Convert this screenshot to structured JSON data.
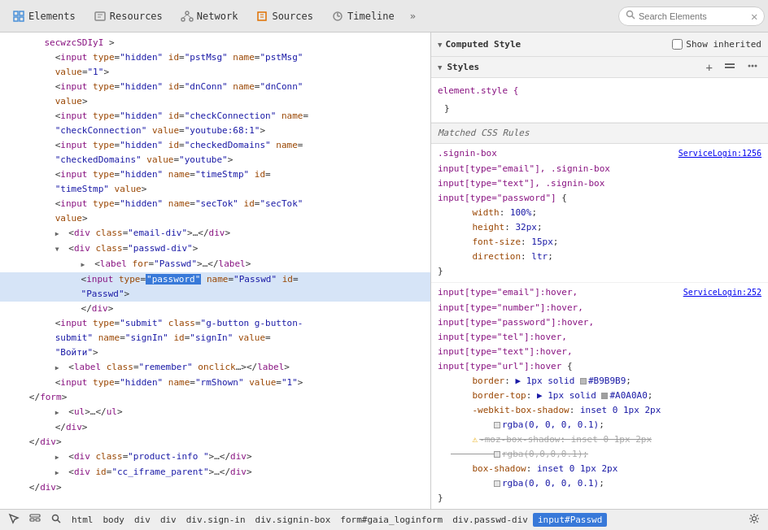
{
  "toolbar": {
    "tabs": [
      {
        "id": "elements",
        "label": "Elements",
        "icon": "elements"
      },
      {
        "id": "resources",
        "label": "Resources",
        "icon": "resources"
      },
      {
        "id": "network",
        "label": "Network",
        "icon": "network"
      },
      {
        "id": "sources",
        "label": "Sources",
        "icon": "sources"
      },
      {
        "id": "timeline",
        "label": "Timeline",
        "icon": "timeline"
      }
    ],
    "more_label": "»",
    "search_placeholder": "Search Elements"
  },
  "dom": {
    "lines": [
      {
        "indent": 1,
        "html": "secwzcSDIyI &gt;"
      },
      {
        "indent": 2,
        "html": "&lt;<span class='tag-name'>input</span> <span class='attr-name'>type</span>=<span class='attr-value'>\"hidden\"</span> <span class='attr-name'>id</span>=<span class='attr-value'>\"pstMsg\"</span> <span class='attr-name'>name</span>=<span class='attr-value'>\"pstMsg\"</span>"
      },
      {
        "indent": 2,
        "html": "<span class='attr-name'>value</span>=<span class='attr-value'>\"1\"</span>&gt;"
      },
      {
        "indent": 2,
        "html": "&lt;<span class='tag-name'>input</span> <span class='attr-name'>type</span>=<span class='attr-value'>\"hidden\"</span> <span class='attr-name'>id</span>=<span class='attr-value'>\"dnConn\"</span> <span class='attr-name'>name</span>=<span class='attr-value'>\"dnConn\"</span>"
      },
      {
        "indent": 2,
        "html": "<span class='attr-name'>value</span>&gt;"
      },
      {
        "indent": 2,
        "html": "&lt;<span class='tag-name'>input</span> <span class='attr-name'>type</span>=<span class='attr-value'>\"hidden\"</span> <span class='attr-name'>id</span>=<span class='attr-value'>\"checkConnection\"</span> <span class='attr-name'>name</span>="
      },
      {
        "indent": 2,
        "html": "<span class='attr-value'>\"checkConnection\"</span> <span class='attr-name'>value</span>=<span class='attr-value'>\"youtube:68:1\"</span>&gt;"
      },
      {
        "indent": 2,
        "html": "&lt;<span class='tag-name'>input</span> <span class='attr-name'>type</span>=<span class='attr-value'>\"hidden\"</span> <span class='attr-name'>id</span>=<span class='attr-value'>\"checkedDomains\"</span> <span class='attr-name'>name</span>="
      },
      {
        "indent": 2,
        "html": "<span class='attr-value'>\"checkedDomains\"</span> <span class='attr-name'>value</span>=<span class='attr-value'>\"youtube\"</span>&gt;"
      },
      {
        "indent": 2,
        "html": "&lt;<span class='tag-name'>input</span> <span class='attr-name'>type</span>=<span class='attr-value'>\"hidden\"</span> <span class='attr-name'>name</span>=<span class='attr-value'>\"timeStmp\"</span> <span class='attr-name'>id</span>="
      },
      {
        "indent": 2,
        "html": "<span class='attr-value'>\"timeStmp\"</span> <span class='attr-name'>value</span>&gt;"
      },
      {
        "indent": 2,
        "html": "&lt;<span class='tag-name'>input</span> <span class='attr-name'>type</span>=<span class='attr-value'>\"hidden\"</span> <span class='attr-name'>name</span>=<span class='attr-value'>\"secTok\"</span> <span class='attr-name'>id</span>=<span class='attr-value'>\"secTok\"</span>"
      },
      {
        "indent": 2,
        "html": "<span class='attr-name'>value</span>&gt;"
      },
      {
        "indent": 2,
        "html": "<span class='triangle triangle-right'></span> &lt;<span class='tag-name'>div</span> <span class='attr-name'>class</span>=<span class='attr-value'>\"email-div\"</span>&gt;…&lt;/<span class='tag-name'>div</span>&gt;"
      },
      {
        "indent": 2,
        "html": "<span class='triangle triangle-down'></span> &lt;<span class='tag-name'>div</span> <span class='attr-name'>class</span>=<span class='attr-value'>\"passwd-div\"</span>&gt;"
      },
      {
        "indent": 3,
        "html": "<span class='triangle triangle-right'></span> &lt;<span class='tag-name'>label</span> <span class='attr-name'>for</span>=<span class='attr-value'>\"Passwd\"</span>&gt;…&lt;/<span class='tag-name'>label</span>&gt;"
      },
      {
        "indent": 3,
        "html": "&lt;<span class='tag-name'>input</span> <span class='attr-name'>type</span>=<span class='attr-value-highlight'>\"password\"</span> <span class='attr-name'>name</span>=<span class='attr-value'>\"Passwd\"</span> <span class='attr-name'>id</span>=",
        "selected": true
      },
      {
        "indent": 3,
        "html": "<span class='attr-value'>\"Passwd\"</span>&gt;",
        "selected": true
      },
      {
        "indent": 3,
        "html": "&lt;/<span class='tag-name'>div</span>&gt;"
      },
      {
        "indent": 2,
        "html": "&lt;<span class='tag-name'>input</span> <span class='attr-name'>type</span>=<span class='attr-value'>\"submit\"</span> <span class='attr-name'>class</span>=<span class='attr-value'>\"g-button g-button-"
      },
      {
        "indent": 2,
        "html": "<span class='attr-value'>submit\"</span> <span class='attr-name'>name</span>=<span class='attr-value'>\"signIn\"</span> <span class='attr-name'>id</span>=<span class='attr-value'>\"signIn\"</span> <span class='attr-name'>value</span>="
      },
      {
        "indent": 2,
        "html": "<span class='attr-value'>\"Войти\"</span>&gt;"
      },
      {
        "indent": 2,
        "html": "<span class='triangle triangle-right'></span> &lt;<span class='tag-name'>label</span> <span class='attr-name'>class</span>=<span class='attr-value'>\"remember\"</span> <span class='attr-name'>onclick</span>…&gt;&lt;/<span class='tag-name'>label</span>&gt;"
      },
      {
        "indent": 2,
        "html": "&lt;<span class='tag-name'>input</span> <span class='attr-name'>type</span>=<span class='attr-value'>\"hidden\"</span> <span class='attr-name'>name</span>=<span class='attr-value'>\"rmShown\"</span> <span class='attr-name'>value</span>=<span class='attr-value'>\"1\"</span>&gt;"
      },
      {
        "indent": 1,
        "html": "&lt;/<span class='tag-name'>form</span>&gt;"
      },
      {
        "indent": 2,
        "html": "<span class='triangle triangle-right'></span> &lt;<span class='tag-name'>ul</span>&gt;…&lt;/<span class='tag-name'>ul</span>&gt;"
      },
      {
        "indent": 2,
        "html": "&lt;/<span class='tag-name'>div</span>&gt;"
      },
      {
        "indent": 1,
        "html": "&lt;/<span class='tag-name'>div</span>&gt;"
      },
      {
        "indent": 2,
        "html": "<span class='triangle triangle-right'></span> &lt;<span class='tag-name'>div</span> <span class='attr-name'>class</span>=<span class='attr-value'>\"product-info \"</span>&gt;…&lt;/<span class='tag-name'>div</span>&gt;"
      },
      {
        "indent": 2,
        "html": "<span class='triangle triangle-right'></span> &lt;<span class='tag-name'>div</span> <span class='attr-name'>id</span>=<span class='attr-value'>\"cc_iframe_parent\"</span>&gt;…&lt;/<span class='tag-name'>div</span>&gt;"
      },
      {
        "indent": 1,
        "html": "&lt;/<span class='tag-name'>div</span>&gt;"
      }
    ]
  },
  "styles": {
    "computed_title": "Computed Style",
    "show_inherited_label": "Show inherited",
    "styles_title": "Styles",
    "element_style": "element.style {",
    "element_style_close": "}",
    "matched_css_label": "Matched CSS Rules",
    "rules": [
      {
        "selector": ".signin-box",
        "source": "ServiceLogin:1256",
        "extra_selectors": [
          "input[type=\"email\"], .signin-box",
          "input[type=\"text\"], .signin-box",
          "input[type=\"password\"] {"
        ],
        "properties": [
          {
            "name": "width",
            "value": "100%;"
          },
          {
            "name": "height",
            "value": "32px;"
          },
          {
            "name": "font-size",
            "value": "15px;"
          },
          {
            "name": "direction",
            "value": "ltr;"
          }
        ]
      },
      {
        "selector": "input[type=\"email\"]:hover,",
        "source": "ServiceLogin:252",
        "extra_selectors": [
          "input[type=\"number\"]:hover,",
          "input[type=\"password\"]:hover,",
          "input[type=\"tel\"]:hover,",
          "input[type=\"text\"]:hover,",
          "input[type=\"url\"]:hover {"
        ],
        "properties": [
          {
            "name": "border",
            "value": "1px solid",
            "color": "#B9B9B9",
            "color_val": "#B9B9B9;"
          },
          {
            "name": "border-top",
            "value": "1px solid",
            "color": "#A0A0A0",
            "color_val": "#A0A0A0;"
          },
          {
            "name": "-webkit-box-shadow",
            "value": "inset 0 1px 2px rgba(0, 0, 0, 0.1);"
          },
          {
            "name": "-moz-box-shadow",
            "value": "inset 0 1px 2px rgba(0,0,0,0.1);",
            "strikethrough": true
          },
          {
            "name": "box-shadow",
            "value": "inset 0 1px 2px",
            "color": "rgba(0,0,0,0.1)",
            "color_val": "rgba(0, 0, 0, 0.1);"
          }
        ]
      }
    ]
  },
  "breadcrumb": {
    "icons": [
      "select-icon",
      "dom-icon",
      "search-icon"
    ],
    "items": [
      "html",
      "body",
      "div",
      "div",
      "div.sign-in",
      "div.signin-box",
      "form#gaia_loginform",
      "div.passwd-div",
      "input#Passwd"
    ],
    "settings_icon": "gear-icon"
  }
}
